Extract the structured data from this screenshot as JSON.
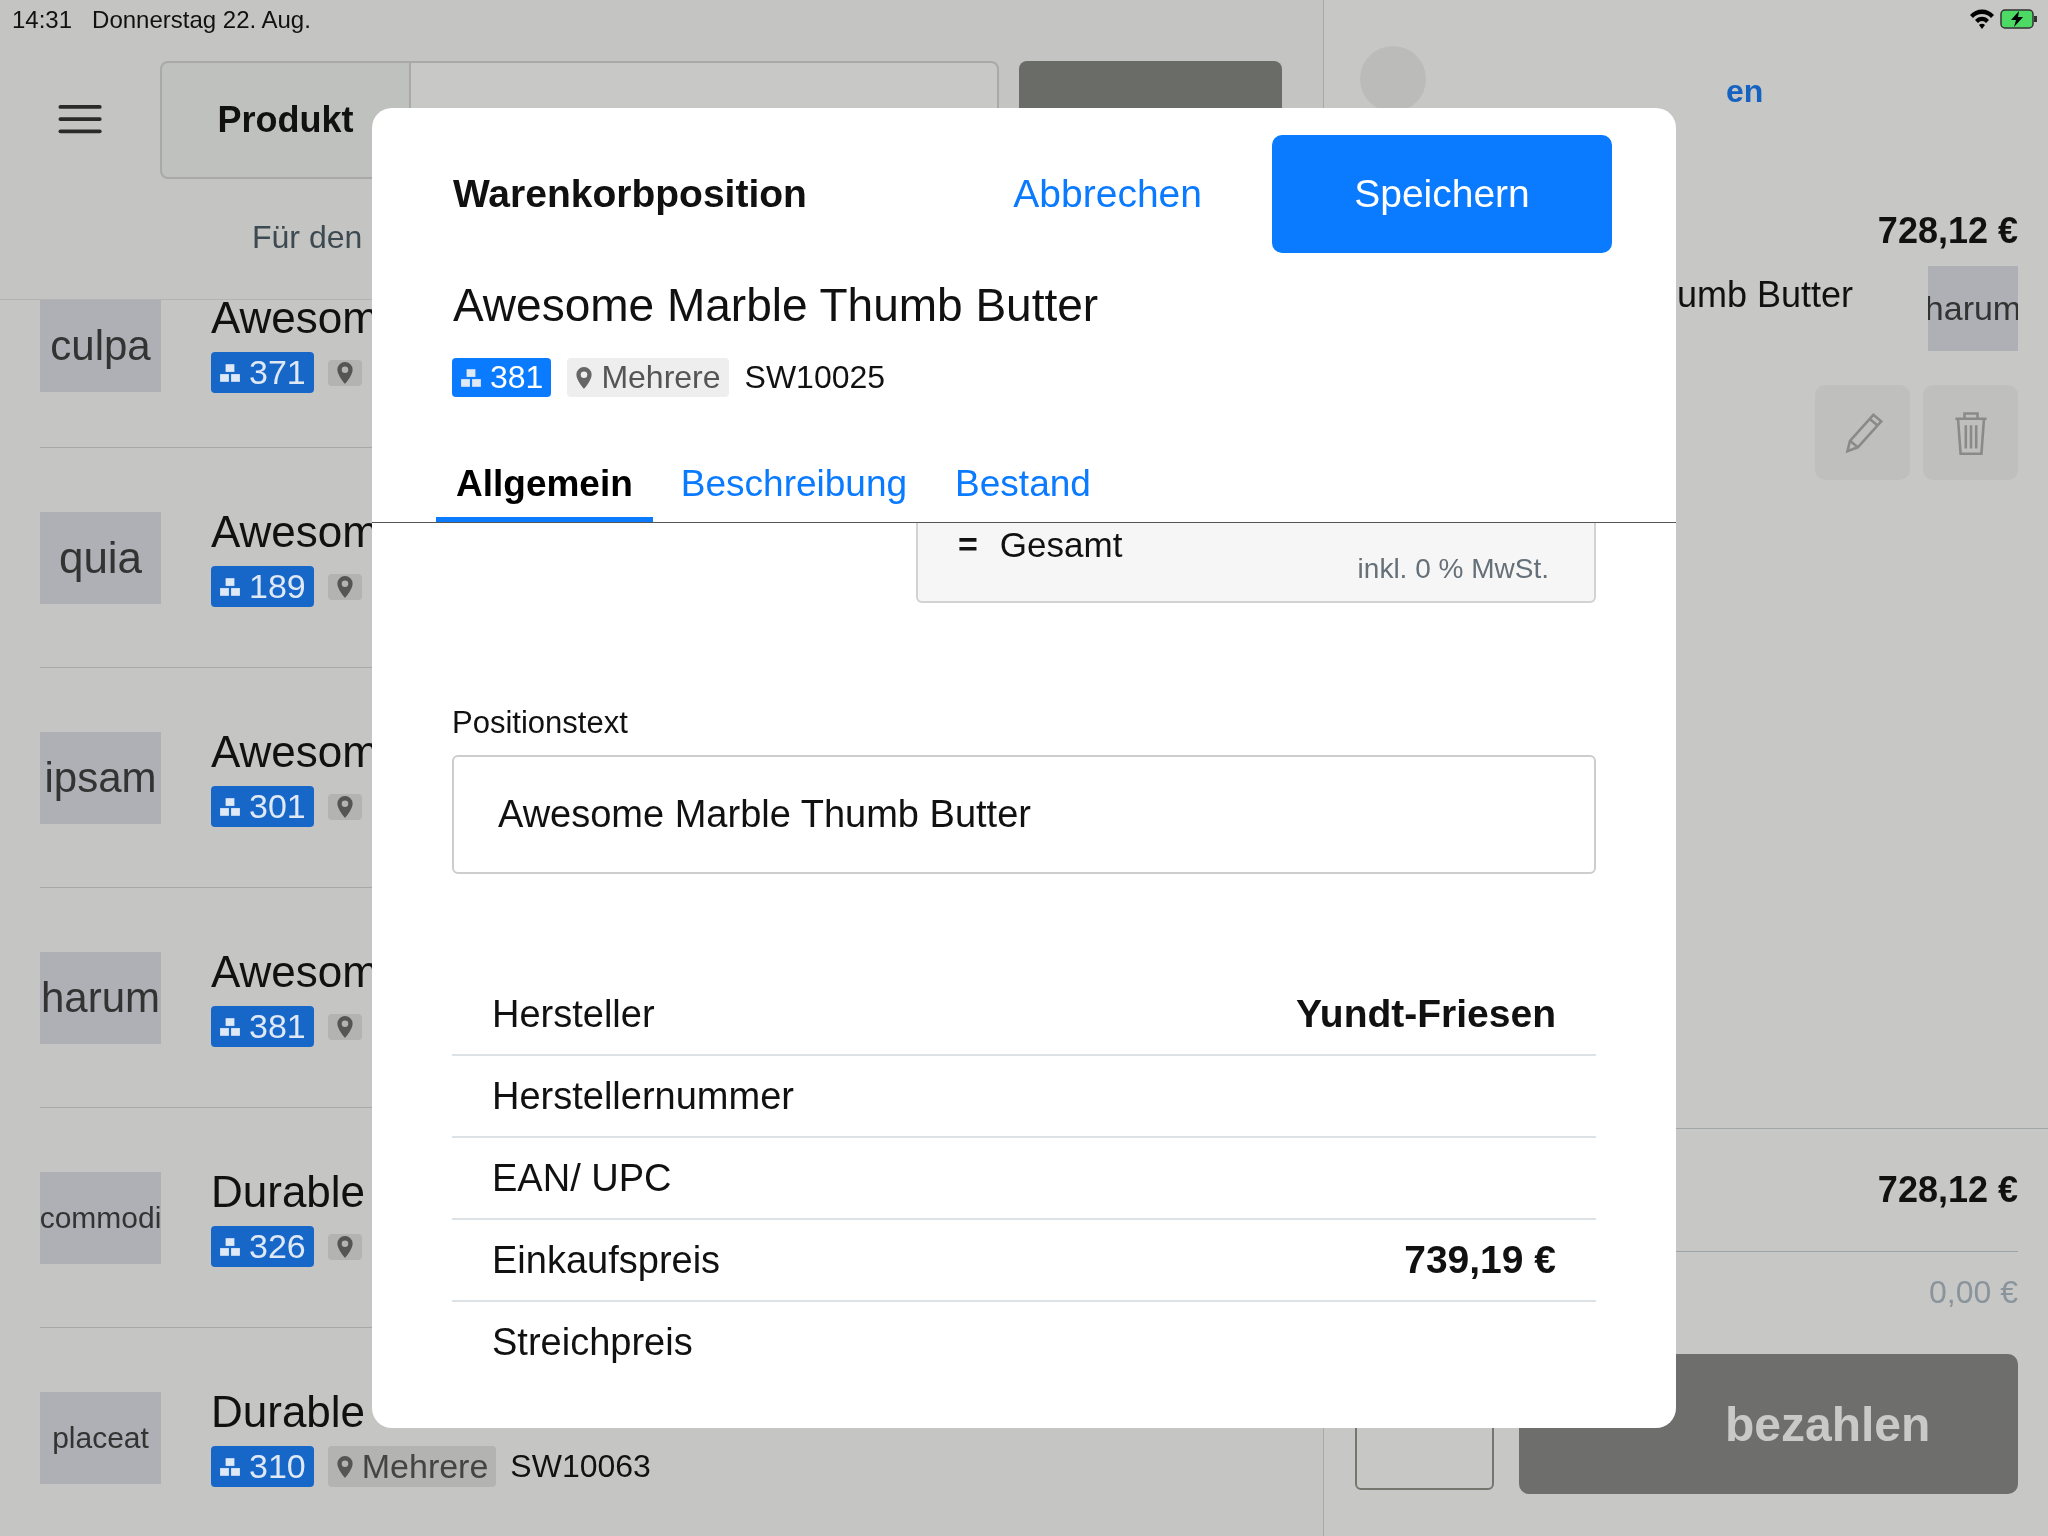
{
  "status_bar": {
    "time": "14:31",
    "date": "Donnerstag 22. Aug."
  },
  "toolbar": {
    "segment": "Produkt",
    "subtitle": "Für den"
  },
  "products": [
    {
      "thumb": "culpa",
      "title": "Awesom",
      "stock": "371"
    },
    {
      "thumb": "quia",
      "title": "Awesom",
      "stock": "189"
    },
    {
      "thumb": "ipsam",
      "title": "Awesom",
      "stock": "301"
    },
    {
      "thumb": "harum",
      "title": "Awesom",
      "stock": "381"
    },
    {
      "thumb": "commodi",
      "title": "Durable",
      "stock": "326"
    },
    {
      "thumb": "placeat",
      "title": "Durable",
      "stock": "310",
      "location": "Mehrere",
      "sku": "SW10063"
    }
  ],
  "cart": {
    "link": "en",
    "total": "728,12 €",
    "item": {
      "name": "umb Butter",
      "thumb": "harum"
    },
    "sum": "728,12 €",
    "paid": "0,00 €",
    "pay_button": "bezahlen"
  },
  "dialog": {
    "title": "Warenkorbposition",
    "cancel": "Abbrechen",
    "save": "Speichern",
    "product": "Awesome Marble Thumb Butter",
    "stock": "381",
    "location": "Mehrere",
    "sku": "SW10025",
    "tabs": [
      {
        "label": "Allgemein",
        "selected": true
      },
      {
        "label": "Beschreibung",
        "selected": false
      },
      {
        "label": "Bestand",
        "selected": false
      }
    ],
    "total_card": {
      "symbol": "=",
      "label": "Gesamt",
      "tax_note": "inkl. 0 % MwSt."
    },
    "position_text": {
      "label": "Positionstext",
      "value": "Awesome Marble Thumb Butter"
    },
    "details": [
      {
        "label": "Hersteller",
        "value": "Yundt-Friesen"
      },
      {
        "label": "Herstellernummer"
      },
      {
        "label": "EAN/ UPC"
      },
      {
        "label": "Einkaufspreis",
        "value": "739,19 €"
      },
      {
        "label": "Streichpreis"
      }
    ]
  }
}
